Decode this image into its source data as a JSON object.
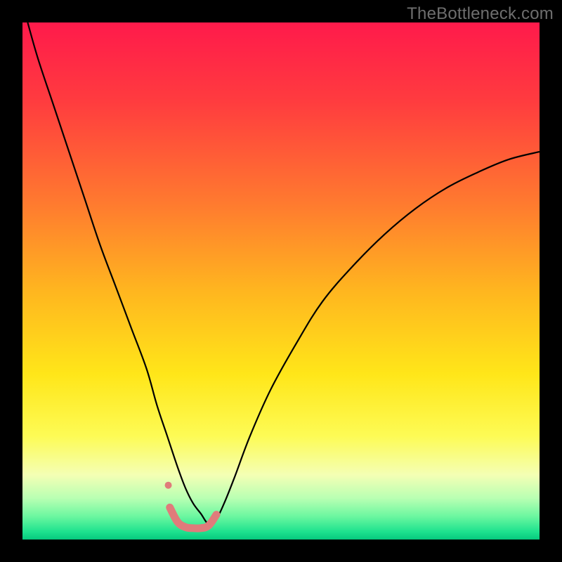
{
  "watermark": "TheBottleneck.com",
  "chart_data": {
    "type": "line",
    "title": "",
    "subtitle": "",
    "xlabel": "",
    "ylabel": "",
    "xlim": [
      0,
      100
    ],
    "ylim": [
      0,
      100
    ],
    "grid": false,
    "legend": null,
    "annotations": [],
    "background_gradient_stops": [
      {
        "offset": 0.0,
        "color": "#ff1a4b"
      },
      {
        "offset": 0.15,
        "color": "#ff3b3f"
      },
      {
        "offset": 0.35,
        "color": "#ff7a2f"
      },
      {
        "offset": 0.52,
        "color": "#ffb61f"
      },
      {
        "offset": 0.68,
        "color": "#ffe619"
      },
      {
        "offset": 0.8,
        "color": "#fdfb55"
      },
      {
        "offset": 0.875,
        "color": "#f4ffb4"
      },
      {
        "offset": 0.92,
        "color": "#b9ffb3"
      },
      {
        "offset": 0.955,
        "color": "#6cf7a0"
      },
      {
        "offset": 0.985,
        "color": "#1de28e"
      },
      {
        "offset": 1.0,
        "color": "#06c97e"
      }
    ],
    "series": [
      {
        "name": "bottleneck-curve",
        "stroke": "#000000",
        "stroke_width": 2.2,
        "x": [
          1,
          3,
          6,
          9,
          12,
          15,
          18,
          21,
          24,
          26,
          28,
          30,
          31.5,
          33,
          34.5,
          36,
          37.5,
          39,
          41,
          44,
          48,
          53,
          58,
          64,
          70,
          76,
          82,
          88,
          94,
          100
        ],
        "y": [
          100,
          93,
          84,
          75,
          66,
          57,
          49,
          41,
          33,
          26,
          20,
          14,
          10,
          7,
          5,
          3,
          4,
          7,
          12,
          20,
          29,
          38,
          46,
          53,
          59,
          64,
          68,
          71,
          73.5,
          75
        ]
      },
      {
        "name": "highlight-band",
        "stroke": "#e07b7b",
        "stroke_width": 11,
        "linecap": "round",
        "x": [
          28.5,
          30,
          31.5,
          33,
          34.5,
          36,
          37.5
        ],
        "y": [
          6.2,
          3.4,
          2.4,
          2.2,
          2.2,
          2.7,
          4.8
        ]
      },
      {
        "name": "highlight-dot",
        "type": "scatter",
        "fill": "#e07b7b",
        "radius": 5,
        "x": [
          28.2
        ],
        "y": [
          10.5
        ]
      }
    ]
  }
}
